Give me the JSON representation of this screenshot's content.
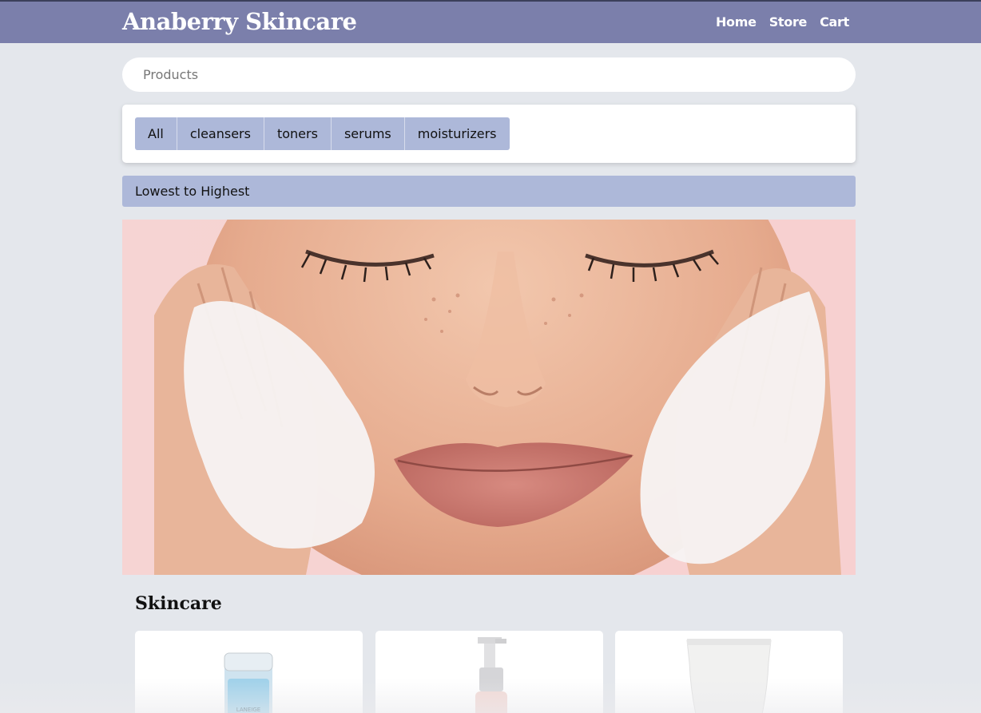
{
  "brand": {
    "title": "Anaberry Skincare"
  },
  "nav": {
    "links": [
      "Home",
      "Store",
      "Cart"
    ]
  },
  "search": {
    "placeholder": "Products"
  },
  "filters": [
    "All",
    "cleansers",
    "toners",
    "serums",
    "moisturizers"
  ],
  "sort": {
    "label": "Lowest to Highest"
  },
  "hero": {
    "alt": "woman-washing-face-with-foam"
  },
  "section": {
    "title": "Skincare"
  },
  "products": [
    {
      "image": "blue-bottle-product-image",
      "brand_text": "LANEIGE"
    },
    {
      "image": "pump-bottle-product-image"
    },
    {
      "image": "white-tube-product-image"
    }
  ],
  "colors": {
    "navbar": "#7b7fab",
    "accent": "#adb8d9",
    "background": "#e4e7ec"
  }
}
